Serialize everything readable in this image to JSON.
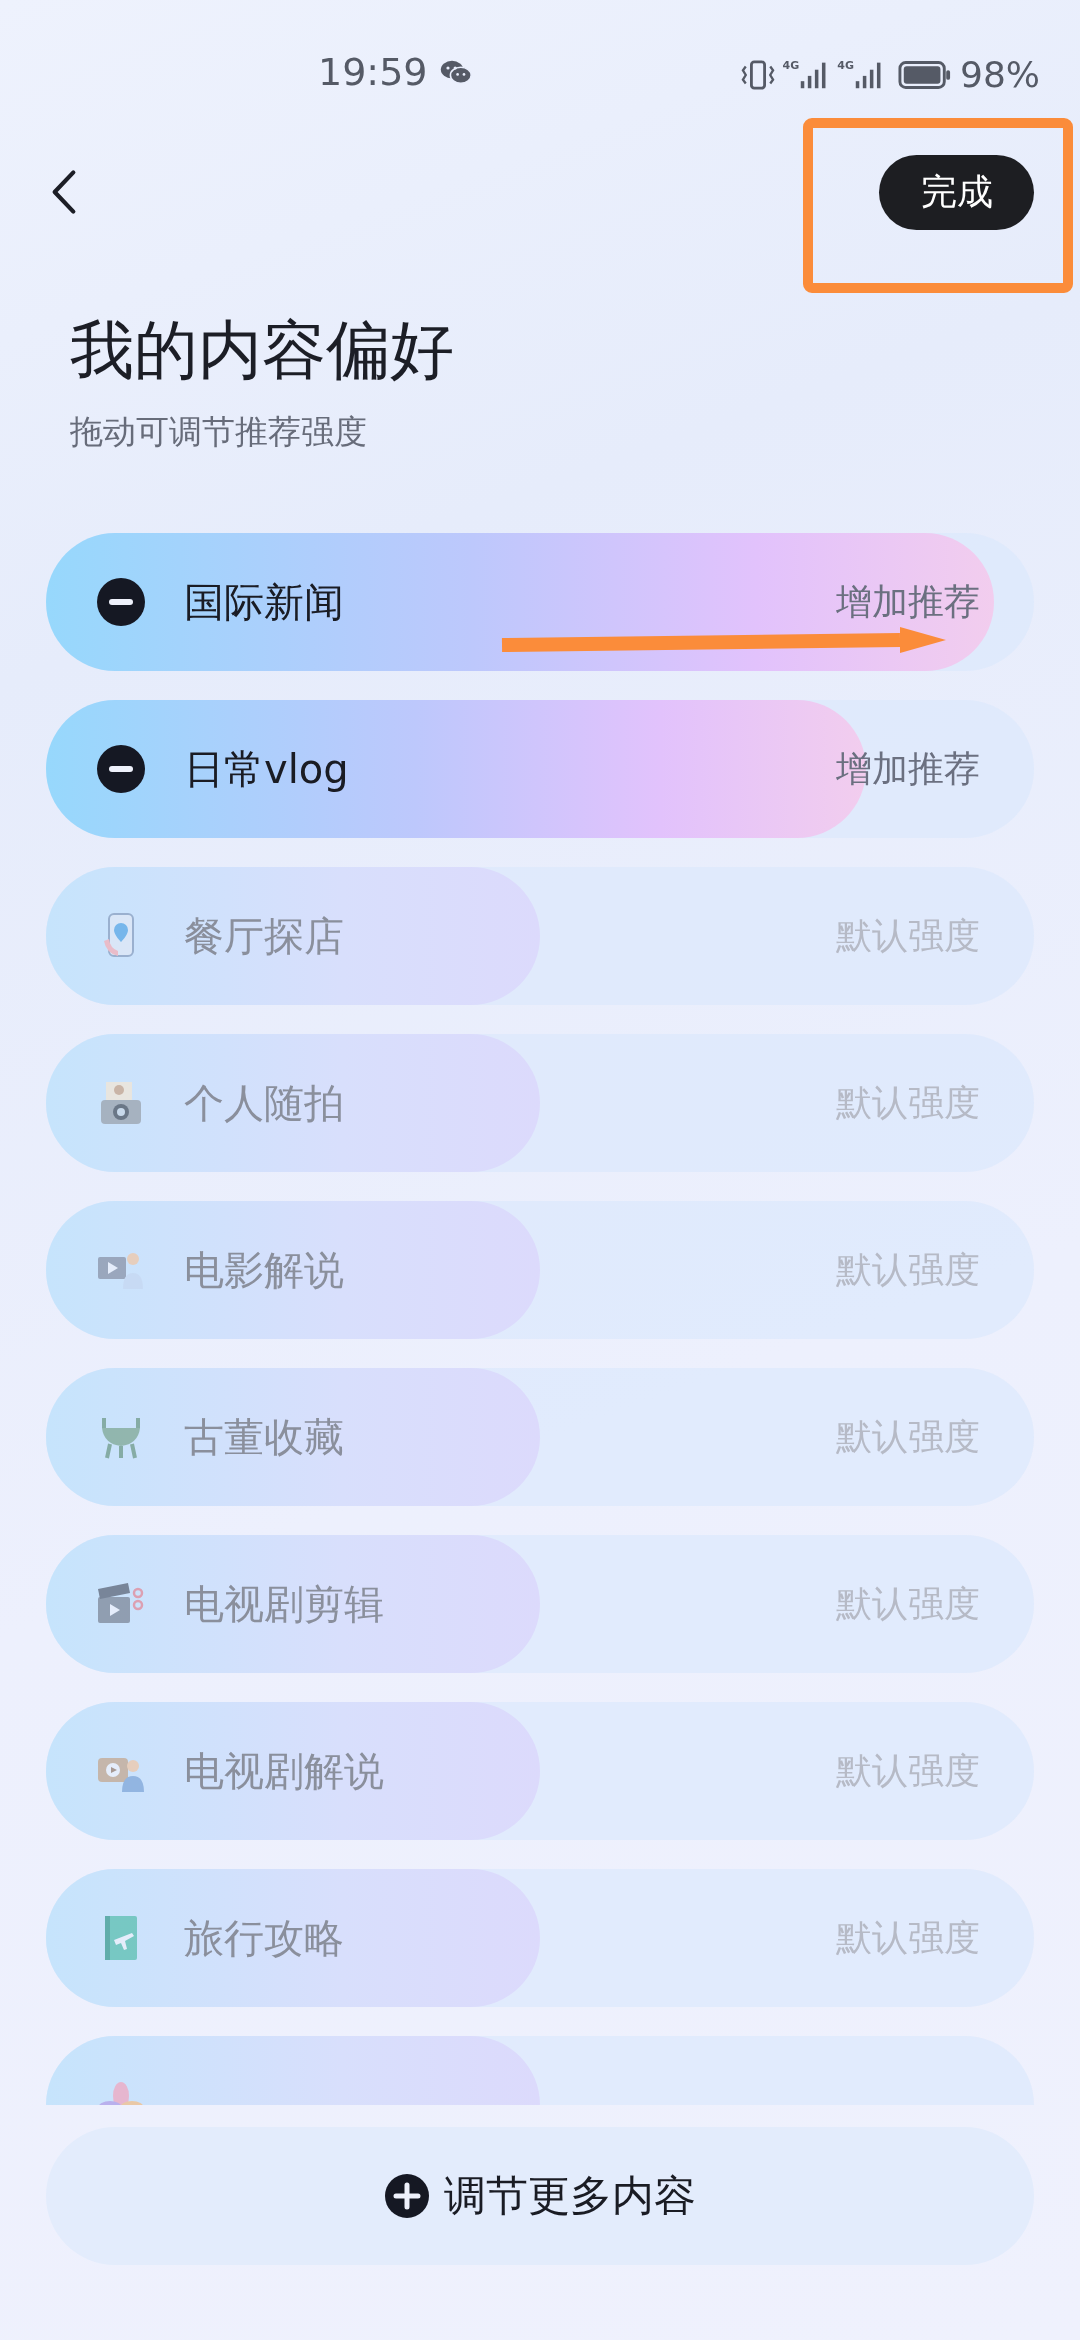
{
  "status_bar": {
    "time": "19:59",
    "network": [
      "4G",
      "4G"
    ],
    "battery": "98%"
  },
  "header": {
    "done_button": "完成"
  },
  "title": "我的内容偏好",
  "subtitle": "拖动可调节推荐强度",
  "items": [
    {
      "label": "国际新闻",
      "kind": "adjusted",
      "level": 0.96,
      "strength": "增加推荐"
    },
    {
      "label": "日常vlog",
      "kind": "adjusted",
      "level": 0.83,
      "strength": "增加推荐"
    },
    {
      "label": "餐厅探店",
      "kind": "default",
      "level": 0.5,
      "strength": "默认强度"
    },
    {
      "label": "个人随拍",
      "kind": "default",
      "level": 0.5,
      "strength": "默认强度"
    },
    {
      "label": "电影解说",
      "kind": "default",
      "level": 0.5,
      "strength": "默认强度"
    },
    {
      "label": "古董收藏",
      "kind": "default",
      "level": 0.5,
      "strength": "默认强度"
    },
    {
      "label": "电视剧剪辑",
      "kind": "default",
      "level": 0.5,
      "strength": "默认强度"
    },
    {
      "label": "电视剧解说",
      "kind": "default",
      "level": 0.5,
      "strength": "默认强度"
    },
    {
      "label": "旅行攻略",
      "kind": "default",
      "level": 0.5,
      "strength": "默认强度"
    },
    {
      "kind": "default",
      "level": 0.5
    }
  ],
  "more_button": "调节更多内容"
}
